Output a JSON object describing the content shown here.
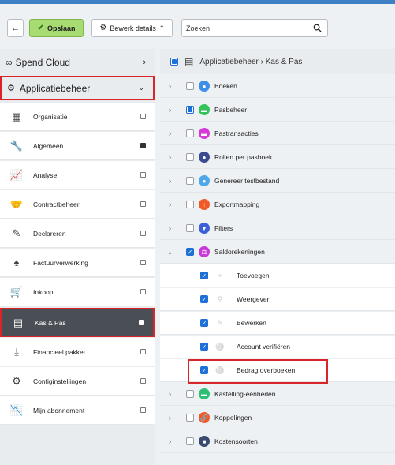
{
  "toolbar": {
    "back_icon": "arrow-left-icon",
    "save_label": "Opslaan",
    "edit_label": "Bewerk details",
    "search_placeholder": "Zoeken"
  },
  "sidebar": {
    "spend_cloud": "Spend Cloud",
    "app_mgmt": "Applicatiebeheer",
    "items": [
      {
        "label": "Organisatie",
        "icon": "building-icon",
        "checked": false
      },
      {
        "label": "Algemeen",
        "icon": "wrench-icon",
        "checked": true
      },
      {
        "label": "Analyse",
        "icon": "chart-icon",
        "checked": false
      },
      {
        "label": "Contractbeheer",
        "icon": "handshake-icon",
        "checked": false
      },
      {
        "label": "Declareren",
        "icon": "edit-icon",
        "checked": false
      },
      {
        "label": "Factuurverwerking",
        "icon": "stamp-icon",
        "checked": false
      },
      {
        "label": "Inkoop",
        "icon": "cart-icon",
        "checked": false
      },
      {
        "label": "Kas & Pas",
        "icon": "cash-register-icon",
        "checked": true,
        "active": true
      },
      {
        "label": "Financieel pakket",
        "icon": "download-icon",
        "checked": false
      },
      {
        "label": "Configinstellingen",
        "icon": "gear-icon",
        "checked": false
      },
      {
        "label": "Mijn abonnement",
        "icon": "line-chart-icon",
        "checked": false
      }
    ]
  },
  "main": {
    "breadcrumb": "Applicatiebeheer › Kas & Pas",
    "rows": [
      {
        "label": "Boeken",
        "color": "#3f8fe8",
        "state": "none"
      },
      {
        "label": "Pasbeheer",
        "color": "#33c35a",
        "state": "partial"
      },
      {
        "label": "Pastransacties",
        "color": "#d63ad6",
        "state": "none"
      },
      {
        "label": "Rollen per pasboek",
        "color": "#3a4b8f",
        "state": "none"
      },
      {
        "label": "Genereer testbestand",
        "color": "#4ea7e8",
        "state": "none"
      },
      {
        "label": "Exportmapping",
        "color": "#f05a28",
        "state": "none"
      },
      {
        "label": "Filters",
        "color": "#3a5fd8",
        "state": "none"
      },
      {
        "label": "Saldorekeningen",
        "color": "#c83ad6",
        "state": "checked",
        "expanded": true
      }
    ],
    "children": [
      {
        "label": "Toevoegen",
        "icon": "plus-icon"
      },
      {
        "label": "Weergeven",
        "icon": "search-icon"
      },
      {
        "label": "Bewerken",
        "icon": "pencil-icon"
      },
      {
        "label": "Account verifiëren",
        "icon": "shield-icon"
      },
      {
        "label": "Bedrag overboeken",
        "icon": "shield-icon"
      }
    ],
    "rows_after": [
      {
        "label": "Kastelling-eenheden",
        "color": "#2fbf74",
        "state": "none"
      },
      {
        "label": "Koppelingen",
        "color": "#f05a28",
        "state": "none"
      },
      {
        "label": "Kostensoorten",
        "color": "#3a4b6f",
        "state": "none"
      }
    ]
  }
}
